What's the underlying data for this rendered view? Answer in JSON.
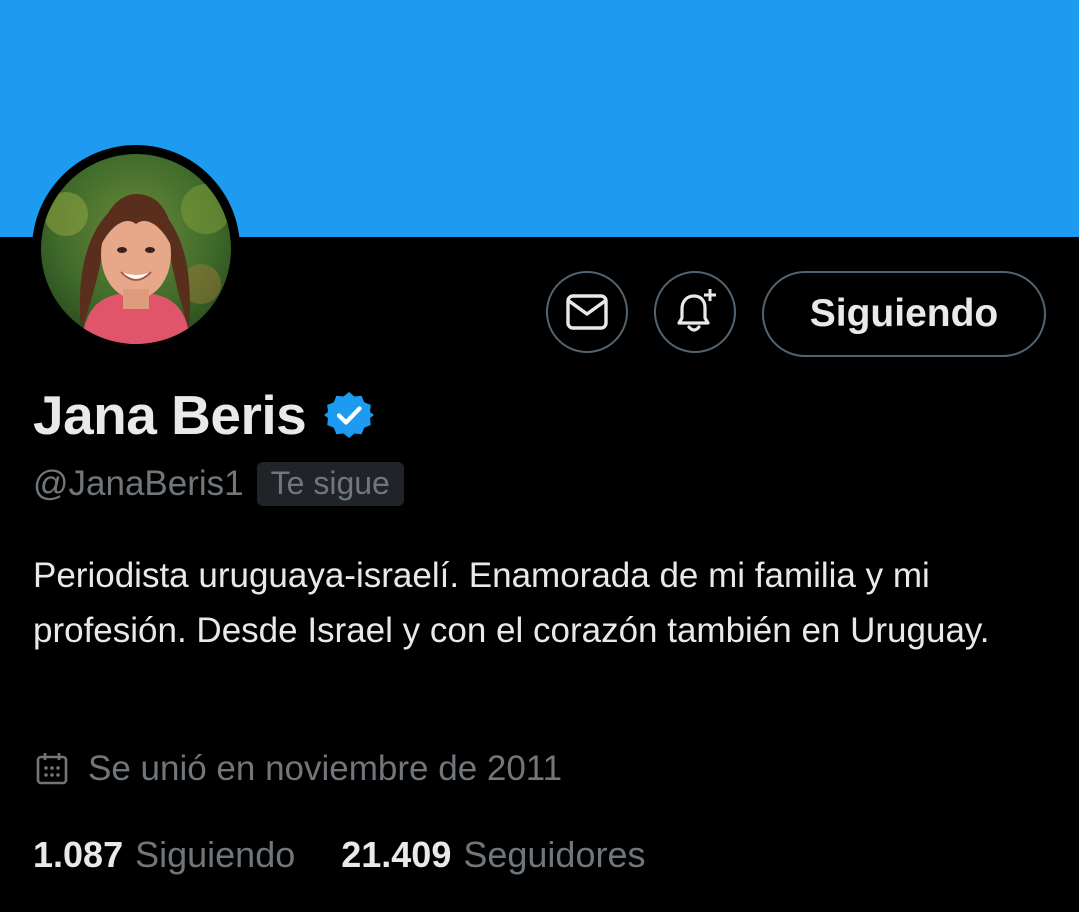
{
  "colors": {
    "banner": "#1d9bf0",
    "background": "#000000",
    "primary_text": "#e7e9ea",
    "secondary_text": "#71767b",
    "button_border": "#536471",
    "verified": "#1d9bf0"
  },
  "icons": {
    "message": "envelope-icon",
    "notify": "bell-plus-icon",
    "verified": "verified-badge-icon",
    "joined": "calendar-icon"
  },
  "profile": {
    "name": "Jana Beris",
    "handle": "@JanaBeris1",
    "follows_you_label": "Te sigue",
    "bio": "Periodista uruguaya-israelí. Enamorada de mi familia y mi profesión. Desde Israel y con el corazón también en Uruguay.",
    "joined": "Se unió en noviembre de 2011"
  },
  "actions": {
    "follow_label": "Siguiendo"
  },
  "stats": {
    "following_count": "1.087",
    "following_label": "Siguiendo",
    "followers_count": "21.409",
    "followers_label": "Seguidores"
  }
}
